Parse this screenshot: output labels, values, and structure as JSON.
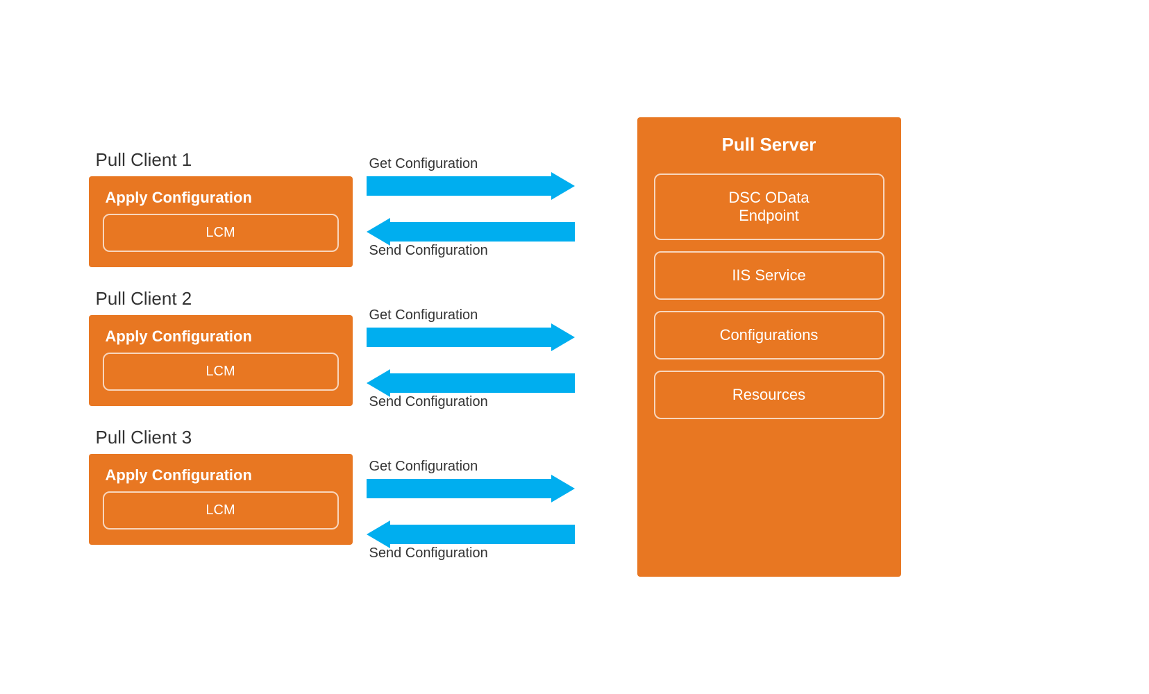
{
  "clients": [
    {
      "label": "Pull Client 1",
      "title": "Apply Configuration",
      "lcm": "LCM"
    },
    {
      "label": "Pull Client 2",
      "title": "Apply Configuration",
      "lcm": "LCM"
    },
    {
      "label": "Pull Client 3",
      "title": "Apply Configuration",
      "lcm": "LCM"
    }
  ],
  "arrows": [
    {
      "get_label": "Get Configuration",
      "send_label": "Send Configuration"
    },
    {
      "get_label": "Get Configuration",
      "send_label": "Send Configuration"
    },
    {
      "get_label": "Get Configuration",
      "send_label": "Send Configuration"
    }
  ],
  "server": {
    "title": "Pull Server",
    "items": [
      "DSC OData\nEndpoint",
      "IIS Service",
      "Configurations",
      "Resources"
    ]
  }
}
